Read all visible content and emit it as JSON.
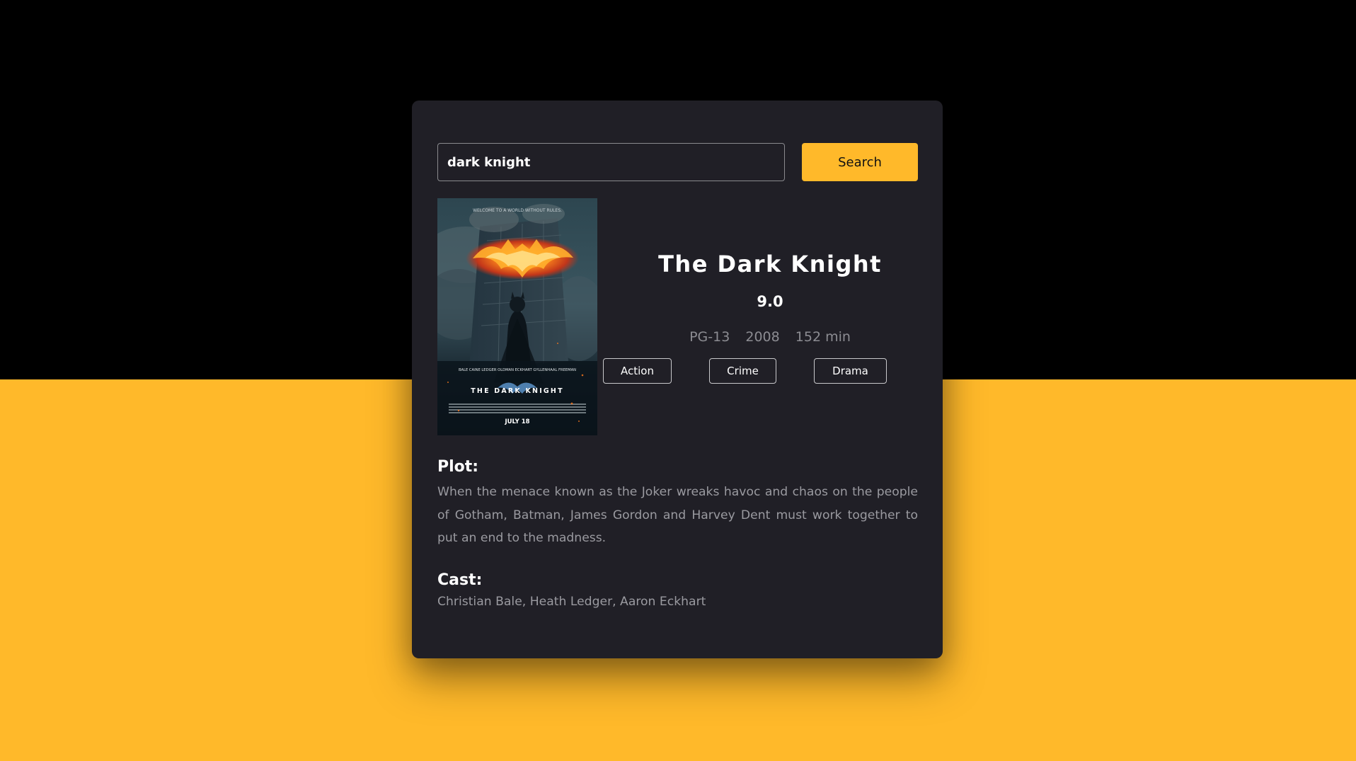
{
  "search": {
    "value": "dark knight",
    "button_label": "Search"
  },
  "movie": {
    "title": "The Dark Knight",
    "rating": "9.0",
    "rated": "PG-13",
    "year": "2008",
    "runtime": "152 min",
    "genres": [
      "Action",
      "Crime",
      "Drama"
    ],
    "plot_label": "Plot:",
    "plot": "When the menace known as the Joker wreaks havoc and chaos on the people of Gotham, Batman, James Gordon and Harvey Dent must work together to put an end to the madness.",
    "cast_label": "Cast:",
    "cast": "Christian Bale, Heath Ledger, Aaron Eckhart"
  },
  "poster": {
    "tagline": "WELCOME TO A WORLD WITHOUT RULES.",
    "credits": "BALE CAINE LEDGER OLDMAN ECKHART GYLLENHAAL FREEMAN",
    "title": "THE DARK KNIGHT",
    "release": "JULY 18"
  },
  "colors": {
    "accent": "#ffb92a",
    "card": "#201f26",
    "top_background": "#000000"
  }
}
